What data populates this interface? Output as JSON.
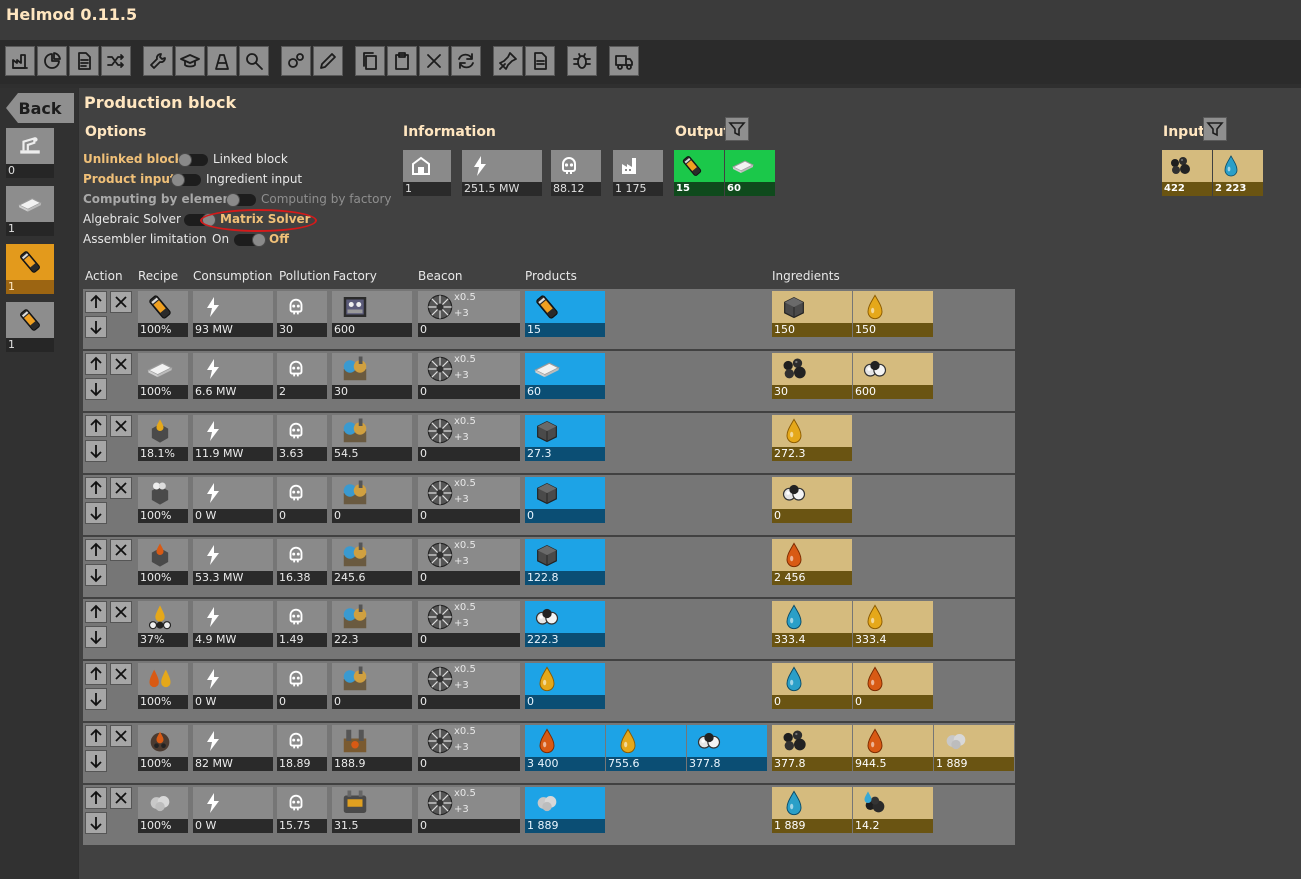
{
  "app": {
    "title": "Helmod 0.11.5"
  },
  "toolbar": {
    "buttons": [
      {
        "icon": "factory-chart-icon"
      },
      {
        "icon": "pie-chart-icon"
      },
      {
        "icon": "document-icon"
      },
      {
        "icon": "shuffle-icon"
      },
      {
        "icon": "wrench-icon"
      },
      {
        "icon": "graduation-cap-icon"
      },
      {
        "icon": "chemical-factory-icon"
      },
      {
        "icon": "search-icon"
      },
      {
        "icon": "gears-icon"
      },
      {
        "icon": "pencil-icon"
      },
      {
        "icon": "copy-icon"
      },
      {
        "icon": "paste-icon"
      },
      {
        "icon": "close-icon"
      },
      {
        "icon": "refresh-icon"
      },
      {
        "icon": "pin-icon"
      },
      {
        "icon": "summary-icon"
      },
      {
        "icon": "bug-icon"
      },
      {
        "icon": "truck-icon"
      }
    ]
  },
  "sidebar": {
    "back_label": "Back",
    "items": [
      {
        "icon": "assembler-icon",
        "count": "0"
      },
      {
        "icon": "plastic-bar-icon",
        "count": "1"
      },
      {
        "icon": "rocket-fuel-icon",
        "count": "1",
        "selected": true
      },
      {
        "icon": "rocket-fuel-icon",
        "count": "1"
      }
    ]
  },
  "block": {
    "title": "Production block"
  },
  "options": {
    "heading": "Options",
    "unlinked": "Unlinked block",
    "linked": "Linked block",
    "product_input": "Product input",
    "ingredient_input": "Ingredient input",
    "by_element": "Computing by element",
    "by_factory": "Computing by factory",
    "algebraic": "Algebraic Solver",
    "matrix": "Matrix Solver",
    "assembler_limit": "Assembler limitation",
    "on": "On",
    "off": "Off"
  },
  "information": {
    "heading": "Information",
    "cells": [
      {
        "icon": "block-icon",
        "value": "1"
      },
      {
        "icon": "energy-icon",
        "value": "251.5 MW"
      },
      {
        "icon": "pollution-icon",
        "value": "88.12"
      },
      {
        "icon": "factory-icon",
        "value": "1 175"
      }
    ]
  },
  "output": {
    "heading": "Output",
    "items": [
      {
        "icon": "rocket-fuel-icon",
        "value": "15"
      },
      {
        "icon": "plastic-bar-icon",
        "value": "60"
      }
    ]
  },
  "input": {
    "heading": "Input",
    "items": [
      {
        "icon": "coal-icon",
        "value": "422"
      },
      {
        "icon": "water-icon",
        "value": "2 223"
      }
    ]
  },
  "table": {
    "headers": {
      "action": "Action",
      "recipe": "Recipe",
      "consumption": "Consumption",
      "pollution": "Pollution",
      "factory": "Factory",
      "beacon": "Beacon",
      "products": "Products",
      "ingredients": "Ingredients"
    },
    "beacon_mult": "x0.5",
    "beacon_mod": "+3",
    "rows": [
      {
        "recipe_icon": "rocket-fuel-icon",
        "recipe": "100%",
        "consumption": "93 MW",
        "pollution": "30",
        "factory_icon": "rocket-silo-icon",
        "factory": "600",
        "beacon": "0",
        "products": [
          {
            "icon": "rocket-fuel-icon",
            "value": "15"
          }
        ],
        "ingredients": [
          {
            "icon": "solid-fuel-icon",
            "value": "150"
          },
          {
            "icon": "light-oil-icon",
            "value": "150"
          }
        ]
      },
      {
        "recipe_icon": "plastic-bar-icon",
        "recipe": "100%",
        "consumption": "6.6 MW",
        "pollution": "2",
        "factory_icon": "chemical-plant-icon",
        "factory": "30",
        "beacon": "0",
        "products": [
          {
            "icon": "plastic-bar-icon",
            "value": "60"
          }
        ],
        "ingredients": [
          {
            "icon": "coal-icon",
            "value": "30"
          },
          {
            "icon": "petroleum-gas-icon",
            "value": "600"
          }
        ]
      },
      {
        "recipe_icon": "solid-fuel-light-icon",
        "recipe": "18.1%",
        "consumption": "11.9 MW",
        "pollution": "3.63",
        "factory_icon": "chemical-plant-icon",
        "factory": "54.5",
        "beacon": "0",
        "products": [
          {
            "icon": "solid-fuel-icon",
            "value": "27.3"
          }
        ],
        "ingredients": [
          {
            "icon": "light-oil-icon",
            "value": "272.3"
          }
        ]
      },
      {
        "recipe_icon": "solid-fuel-gas-icon",
        "recipe": "100%",
        "consumption": "0 W",
        "pollution": "0",
        "factory_icon": "chemical-plant-icon",
        "factory": "0",
        "beacon": "0",
        "products": [
          {
            "icon": "solid-fuel-icon",
            "value": "0"
          }
        ],
        "ingredients": [
          {
            "icon": "petroleum-gas-icon",
            "value": "0"
          }
        ]
      },
      {
        "recipe_icon": "solid-fuel-heavy-icon",
        "recipe": "100%",
        "consumption": "53.3 MW",
        "pollution": "16.38",
        "factory_icon": "chemical-plant-icon",
        "factory": "245.6",
        "beacon": "0",
        "products": [
          {
            "icon": "solid-fuel-icon",
            "value": "122.8"
          }
        ],
        "ingredients": [
          {
            "icon": "heavy-oil-icon",
            "value": "2 456"
          }
        ]
      },
      {
        "recipe_icon": "light-oil-cracking-icon",
        "recipe": "37%",
        "consumption": "4.9 MW",
        "pollution": "1.49",
        "factory_icon": "chemical-plant-icon",
        "factory": "22.3",
        "beacon": "0",
        "products": [
          {
            "icon": "petroleum-gas-icon",
            "value": "222.3"
          }
        ],
        "ingredients": [
          {
            "icon": "water-icon",
            "value": "333.4"
          },
          {
            "icon": "light-oil-icon",
            "value": "333.4"
          }
        ]
      },
      {
        "recipe_icon": "heavy-oil-cracking-icon",
        "recipe": "100%",
        "consumption": "0 W",
        "pollution": "0",
        "factory_icon": "chemical-plant-icon",
        "factory": "0",
        "beacon": "0",
        "products": [
          {
            "icon": "light-oil-icon",
            "value": "0"
          }
        ],
        "ingredients": [
          {
            "icon": "water-icon",
            "value": "0"
          },
          {
            "icon": "heavy-oil-icon",
            "value": "0"
          }
        ]
      },
      {
        "recipe_icon": "coal-liquefaction-icon",
        "recipe": "100%",
        "consumption": "82 MW",
        "pollution": "18.89",
        "factory_icon": "oil-refinery-icon",
        "factory": "188.9",
        "beacon": "0",
        "products": [
          {
            "icon": "heavy-oil-icon",
            "value": "3 400"
          },
          {
            "icon": "light-oil-icon",
            "value": "755.6"
          },
          {
            "icon": "petroleum-gas-icon",
            "value": "377.8"
          }
        ],
        "ingredients": [
          {
            "icon": "coal-icon",
            "value": "377.8"
          },
          {
            "icon": "heavy-oil-icon",
            "value": "944.5"
          },
          {
            "icon": "steam-icon",
            "value": "1 889"
          }
        ]
      },
      {
        "recipe_icon": "steam-icon",
        "recipe": "100%",
        "consumption": "0 W",
        "pollution": "15.75",
        "factory_icon": "boiler-icon",
        "factory": "31.5",
        "beacon": "0",
        "products": [
          {
            "icon": "steam-icon",
            "value": "1 889"
          }
        ],
        "ingredients": [
          {
            "icon": "water-icon",
            "value": "1 889"
          },
          {
            "icon": "coal-water-icon",
            "value": "14.2"
          }
        ]
      }
    ]
  }
}
